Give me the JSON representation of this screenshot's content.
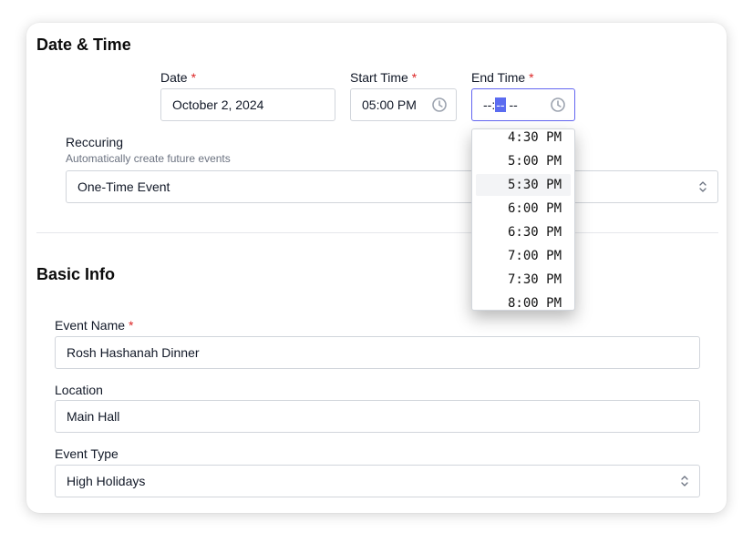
{
  "datetime": {
    "title": "Date & Time",
    "date": {
      "label": "Date",
      "required": "*",
      "value": "October 2, 2024"
    },
    "start": {
      "label": "Start Time",
      "required": "*",
      "value": "05:00 PM"
    },
    "end": {
      "label": "End Time",
      "required": "*",
      "hour": "--",
      "sep": ":",
      "minute": "--",
      "ampm": "--"
    },
    "recurring": {
      "label": "Reccuring",
      "help": "Automatically create future events",
      "value": "One-Time Event"
    }
  },
  "time_options": [
    "4:30 PM",
    "5:00 PM",
    "5:30 PM",
    "6:00 PM",
    "6:30 PM",
    "7:00 PM",
    "7:30 PM",
    "8:00 PM"
  ],
  "highlighted_option": "5:30 PM",
  "basic": {
    "title": "Basic Info",
    "event_name": {
      "label": "Event Name",
      "required": "*",
      "value": "Rosh Hashanah Dinner"
    },
    "location": {
      "label": "Location",
      "value": "Main Hall"
    },
    "event_type": {
      "label": "Event Type",
      "value": "High Holidays"
    }
  },
  "icons": {
    "clock": "clock-icon",
    "select": "chevron-up-down-icon"
  },
  "colors": {
    "required": "#dc2626",
    "focus": "#6366f1",
    "segment_highlight": "#5b6cf0"
  }
}
